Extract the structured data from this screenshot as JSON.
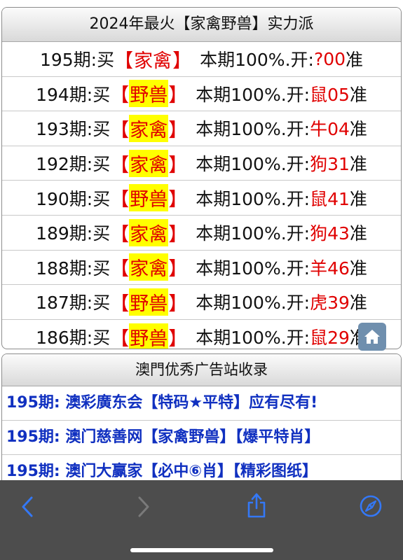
{
  "panel1": {
    "title": "2024年最火【家禽野兽】实力派",
    "rows": [
      {
        "period": "195期:买",
        "open": "【",
        "category": "家禽",
        "close": "】",
        "middle": "本期100%.开:",
        "answer": "?00",
        "suffix": "准",
        "highlight": false
      },
      {
        "period": "194期:买",
        "open": "【",
        "category": "野兽",
        "close": "】",
        "middle": "本期100%.开:",
        "answer": "鼠05",
        "suffix": "准",
        "highlight": true
      },
      {
        "period": "193期:买",
        "open": "【",
        "category": "家禽",
        "close": "】",
        "middle": "本期100%.开:",
        "answer": "牛04",
        "suffix": "准",
        "highlight": true
      },
      {
        "period": "192期:买",
        "open": "【",
        "category": "家禽",
        "close": "】",
        "middle": "本期100%.开:",
        "answer": "狗31",
        "suffix": "准",
        "highlight": true
      },
      {
        "period": "190期:买",
        "open": "【",
        "category": "野兽",
        "close": "】",
        "middle": "本期100%.开:",
        "answer": "鼠41",
        "suffix": "准",
        "highlight": true
      },
      {
        "period": "189期:买",
        "open": "【",
        "category": "家禽",
        "close": "】",
        "middle": "本期100%.开:",
        "answer": "狗43",
        "suffix": "准",
        "highlight": true
      },
      {
        "period": "188期:买",
        "open": "【",
        "category": "家禽",
        "close": "】",
        "middle": "本期100%.开:",
        "answer": "羊46",
        "suffix": "准",
        "highlight": true
      },
      {
        "period": "187期:买",
        "open": "【",
        "category": "野兽",
        "close": "】",
        "middle": "本期100%.开:",
        "answer": "虎39",
        "suffix": "准",
        "highlight": true
      },
      {
        "period": "186期:买",
        "open": "【",
        "category": "野兽",
        "close": "】",
        "middle": "本期100%.开:",
        "answer": "鼠29",
        "suffix": "准",
        "highlight": true
      }
    ]
  },
  "panel2": {
    "title": "澳門优秀广告站收录",
    "links": [
      "195期: 澳彩廣东会【特码★平特】应有尽有!",
      "195期: 澳门慈善网【家禽野兽】【爆平特肖】",
      "195期: 澳门大赢家【必中⑥肖】【精彩图纸】"
    ]
  },
  "toolbar": {
    "icons": [
      "back-icon",
      "forward-icon",
      "share-icon",
      "compass-icon"
    ]
  },
  "colors": {
    "accent_red": "#e00000",
    "highlight_yellow": "#ffff00",
    "link_blue": "#1030c0",
    "toolbar_bg": "#4d4d4d",
    "toolbar_icon_blue": "#3478f6"
  }
}
